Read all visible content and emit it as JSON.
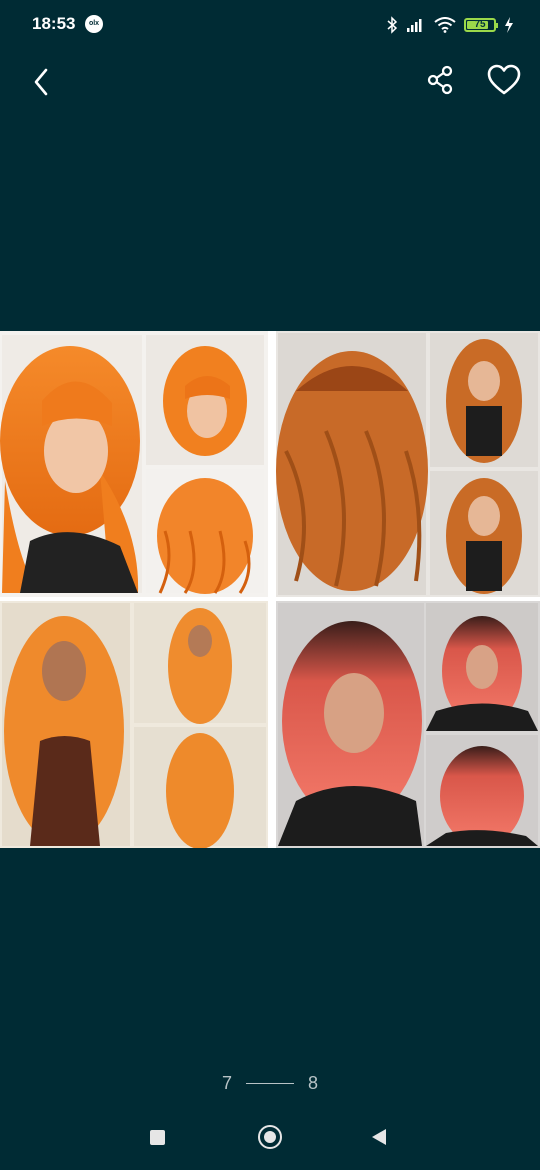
{
  "status_bar": {
    "time": "18:53",
    "notification_badge": "olx",
    "battery_level": "75",
    "battery_fraction": 0.75,
    "icons": [
      "bluetooth-icon",
      "signal-icon",
      "wifi-icon",
      "battery-icon",
      "charging-icon"
    ]
  },
  "toolbar": {
    "back_icon": "chevron-left-icon",
    "share_icon": "share-icon",
    "favorite_icon": "heart-outline-icon"
  },
  "gallery": {
    "collage_tiles": [
      "wig-collage-ginger-short-wavy-bangs",
      "wig-collage-copper-long-wavy-bangs",
      "wig-collage-orange-long-wavy",
      "wig-collage-ombre-pink-wavy-bangs"
    ]
  },
  "pager": {
    "current": "7",
    "total": "8"
  },
  "colors": {
    "background": "#002b34",
    "battery": "#9bd94a",
    "pager_text": "#b7c3c6"
  }
}
